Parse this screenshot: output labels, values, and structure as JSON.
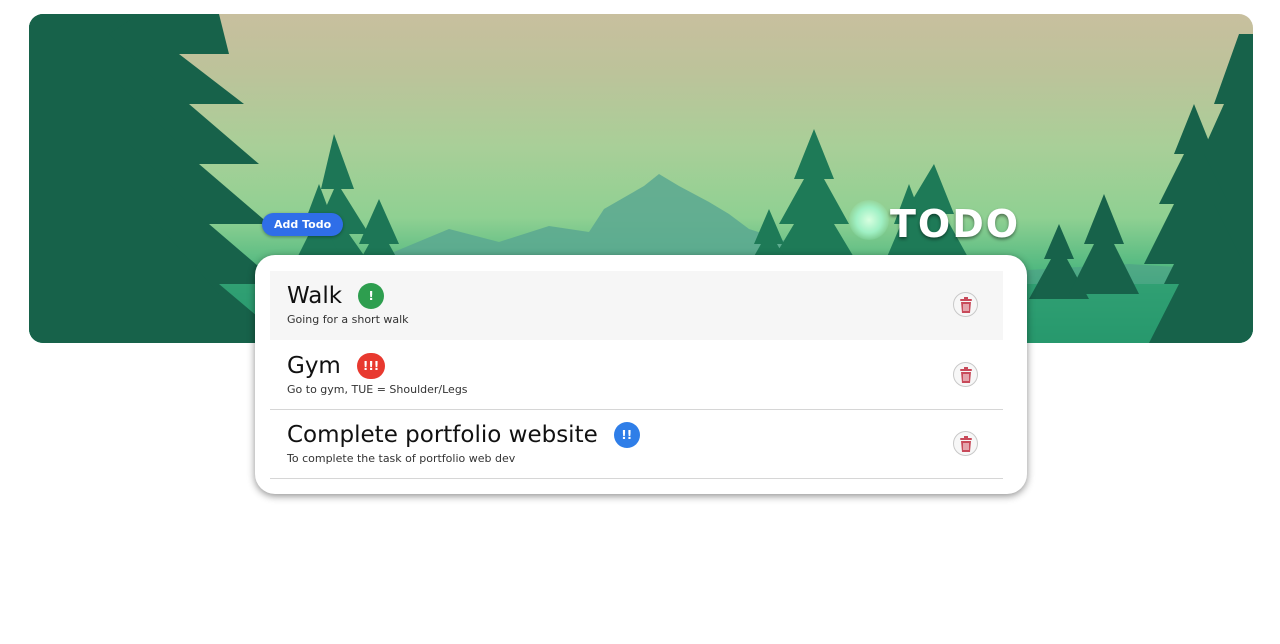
{
  "app": {
    "title": "TODO",
    "add_button_label": "Add Todo"
  },
  "colors": {
    "accent": "#2f6ee8",
    "priority_low": "#2e9e4f",
    "priority_medium": "#2f7ee8",
    "priority_high": "#e8392f",
    "delete_icon": "#c84a5a"
  },
  "todos": [
    {
      "title": "Walk",
      "description": "Going for a short walk",
      "priority": "!",
      "priority_color": "#2e9e4f",
      "delete_icon": "trash-icon"
    },
    {
      "title": "Gym",
      "description": "Go to gym, TUE = Shoulder/Legs",
      "priority": "!!!",
      "priority_color": "#e8392f",
      "delete_icon": "trash-icon"
    },
    {
      "title": "Complete portfolio website",
      "description": "To complete the task of portfolio web dev",
      "priority": "!!",
      "priority_color": "#2f7ee8",
      "delete_icon": "trash-icon"
    }
  ]
}
